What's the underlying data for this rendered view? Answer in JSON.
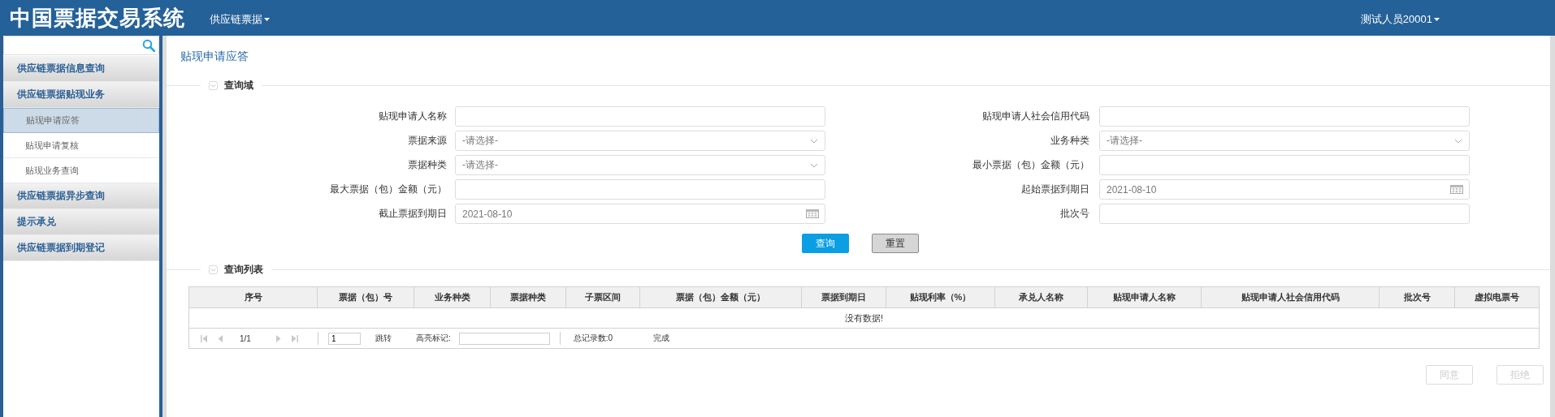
{
  "header": {
    "title": "中国票据交易系统",
    "menu": "供应链票据",
    "user": "测试人员20001"
  },
  "sidebar": {
    "items": [
      {
        "label": "供应链票据信息查询"
      },
      {
        "label": "供应链票据贴现业务",
        "children": [
          {
            "label": "贴现申请应答",
            "selected": true
          },
          {
            "label": "贴现申请复核",
            "selected": false
          },
          {
            "label": "贴现业务查询",
            "selected": false
          }
        ]
      },
      {
        "label": "供应链票据异步查询"
      },
      {
        "label": "提示承兑"
      },
      {
        "label": "供应链票据到期登记"
      }
    ]
  },
  "page_title": "贴现申请应答",
  "query_section": {
    "title": "查询域",
    "fields": [
      {
        "label": "贴现申请人名称",
        "kind": "text"
      },
      {
        "label": "贴现申请人社会信用代码",
        "kind": "text"
      },
      {
        "label": "票据来源",
        "kind": "select",
        "placeholder": "-请选择-"
      },
      {
        "label": "业务种类",
        "kind": "select",
        "placeholder": "-请选择-"
      },
      {
        "label": "票据种类",
        "kind": "select",
        "placeholder": "-请选择-"
      },
      {
        "label": "最小票据（包）金额（元）",
        "kind": "text"
      },
      {
        "label": "最大票据（包）金额（元）",
        "kind": "text"
      },
      {
        "label": "起始票据到期日",
        "kind": "date",
        "value": "2021-08-10"
      },
      {
        "label": "截止票据到期日",
        "kind": "date",
        "value": "2021-08-10"
      },
      {
        "label": "批次号",
        "kind": "text"
      }
    ],
    "buttons": [
      {
        "label": "查询",
        "kind": "primary"
      },
      {
        "label": "重置",
        "kind": "secondary"
      }
    ]
  },
  "list_section": {
    "title": "查询列表",
    "table": {
      "columns": [
        "序号",
        "票据（包）号",
        "业务种类",
        "票据种类",
        "子票区间",
        "票据（包）金额（元）",
        "票据到期日",
        "贴现利率（%）",
        "承兑人名称",
        "贴现申请人名称",
        "贴现申请人社会信用代码",
        "批次号",
        "虚拟电票号"
      ],
      "empty_message": "没有数据!"
    },
    "pager": {
      "page": "1/1",
      "page_input": "1",
      "jump": "跳转",
      "highlight_label": "高亮标记:",
      "total": "总记录数:0",
      "status": "完成"
    }
  },
  "actions": [
    {
      "label": "同意",
      "disabled": true
    },
    {
      "label": "拒绝",
      "disabled": true
    }
  ]
}
